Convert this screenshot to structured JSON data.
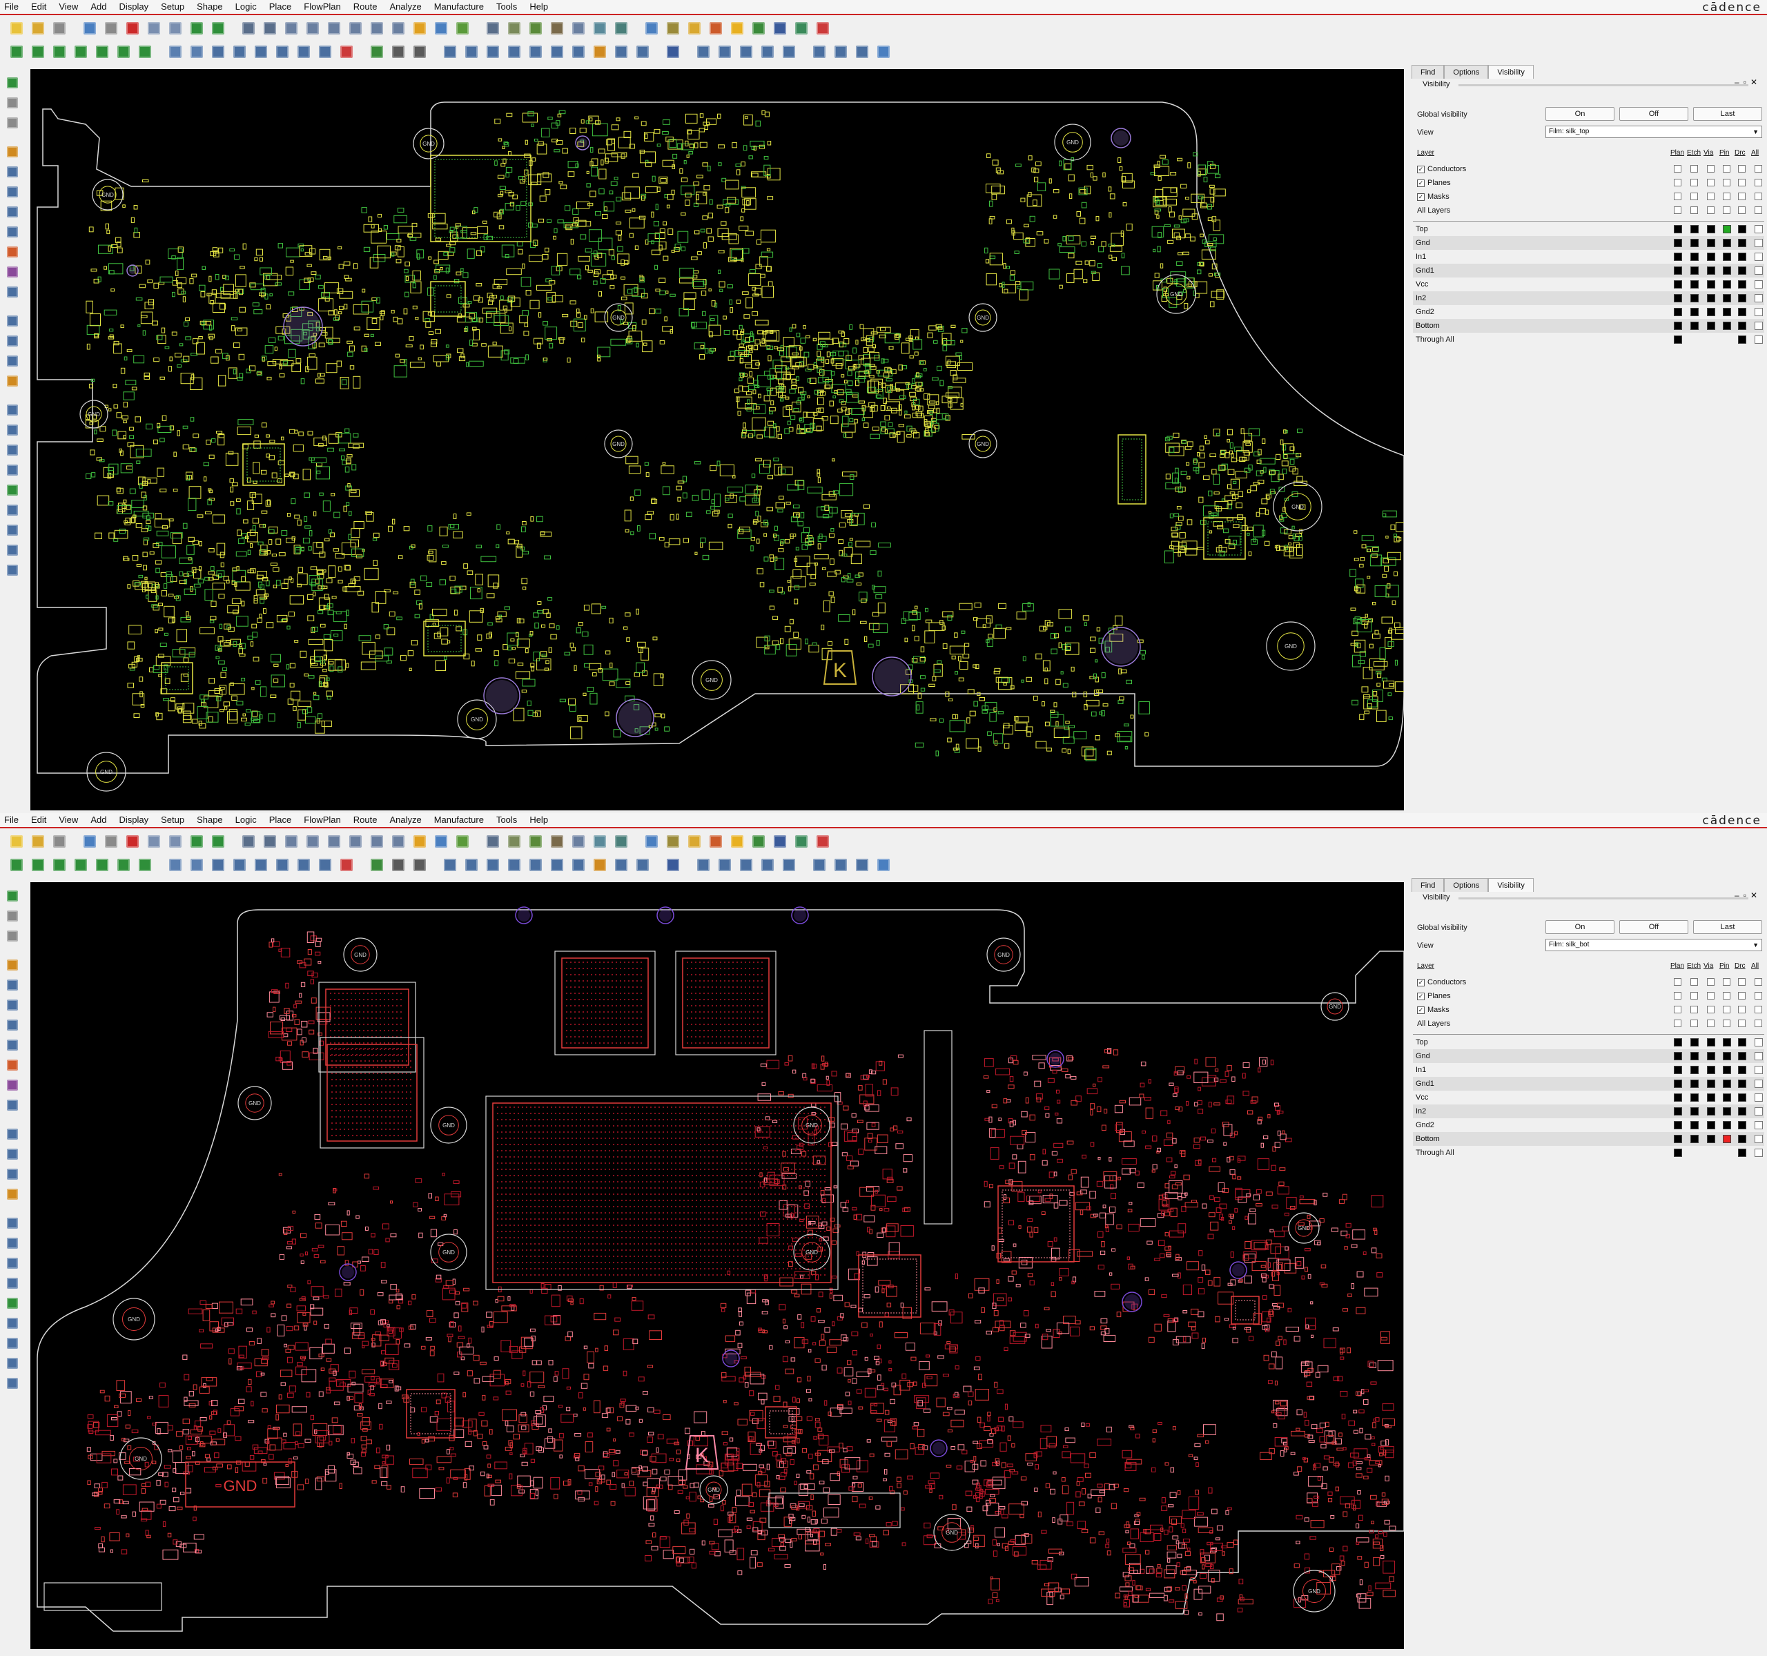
{
  "menu": [
    "File",
    "Edit",
    "View",
    "Add",
    "Display",
    "Setup",
    "Shape",
    "Logic",
    "Place",
    "FlowPlan",
    "Route",
    "Analyze",
    "Manufacture",
    "Tools",
    "Help"
  ],
  "brand": "cādence",
  "toolbar_icons_row1": [
    {
      "name": "new-file-icon",
      "color": "#e8c23a"
    },
    {
      "name": "open-folder-icon",
      "color": "#d9a830"
    },
    {
      "name": "save-icon",
      "color": "#8a8a8a"
    },
    {
      "sep": true
    },
    {
      "name": "move-icon",
      "color": "#4a7fc0"
    },
    {
      "name": "copy-icon",
      "color": "#8a8a8a"
    },
    {
      "name": "delete-icon",
      "color": "#cc2a2a"
    },
    {
      "name": "undo-icon",
      "color": "#7a8fb0"
    },
    {
      "name": "redo-icon",
      "color": "#7a8fb0"
    },
    {
      "name": "ratsnest-icon",
      "color": "#2f8f3a"
    },
    {
      "name": "pin-icon",
      "color": "#2f8f3a"
    },
    {
      "sep": true
    },
    {
      "name": "grid-icon",
      "color": "#5a6e8a"
    },
    {
      "name": "grid-fine-icon",
      "color": "#5a6e8a"
    },
    {
      "name": "zoom-window-icon",
      "color": "#6a7fa0"
    },
    {
      "name": "zoom-in-icon",
      "color": "#6a7fa0"
    },
    {
      "name": "zoom-out-icon",
      "color": "#6a7fa0"
    },
    {
      "name": "zoom-fit-icon",
      "color": "#6a7fa0"
    },
    {
      "name": "zoom-world-icon",
      "color": "#6a7fa0"
    },
    {
      "name": "zoom-previous-icon",
      "color": "#6a7fa0"
    },
    {
      "name": "redraw-icon",
      "color": "#e0a020"
    },
    {
      "name": "3d-view-icon",
      "color": "#4a7fc0"
    },
    {
      "name": "color-dialog-icon",
      "color": "#5a9a3a"
    },
    {
      "sep": true
    },
    {
      "name": "layer-table-icon",
      "color": "#5a6e8a"
    },
    {
      "name": "shape-edit-icon",
      "color": "#7a8a5a"
    },
    {
      "name": "constraint-manager-icon",
      "color": "#5a8a3a"
    },
    {
      "name": "component-icon",
      "color": "#7a6a4a"
    },
    {
      "name": "net-table-icon",
      "color": "#6a7fa0"
    },
    {
      "name": "drc-icon",
      "color": "#5a8a9a"
    },
    {
      "name": "schematic-icon",
      "color": "#4a7f7a"
    },
    {
      "sep": true
    },
    {
      "name": "info-icon",
      "color": "#4a7fc0"
    },
    {
      "name": "properties-icon",
      "color": "#9a8a3a"
    },
    {
      "name": "measure-icon",
      "color": "#d9a830"
    },
    {
      "name": "highlight-icon",
      "color": "#cc5a2a"
    },
    {
      "name": "assign-color-icon",
      "color": "#e8b020"
    },
    {
      "name": "dehighlight-icon",
      "color": "#3a8a3a"
    },
    {
      "name": "report-icon",
      "color": "#3a5a9a"
    },
    {
      "name": "hourglass-icon",
      "color": "#3a8a5a"
    },
    {
      "name": "visibility-icon",
      "color": "#cc3a3a"
    }
  ],
  "toolbar_icons_row2": [
    {
      "name": "layer-top-icon",
      "color": "#2f8f3a"
    },
    {
      "name": "layer-gnd-icon",
      "color": "#2f8f3a"
    },
    {
      "name": "layer-in1-icon",
      "color": "#2f8f3a"
    },
    {
      "name": "layer-gnd1-icon",
      "color": "#2f8f3a"
    },
    {
      "name": "layer-vcc-icon",
      "color": "#2f8f3a"
    },
    {
      "name": "layer-in2-icon",
      "color": "#2f8f3a"
    },
    {
      "name": "layer-bottom-icon",
      "color": "#2f8f3a"
    },
    {
      "sep": true
    },
    {
      "name": "add-connect-icon",
      "color": "#5a7fb0"
    },
    {
      "name": "slide-icon",
      "color": "#5a7fb0"
    },
    {
      "name": "via-icon",
      "color": "#4a6fa0"
    },
    {
      "name": "fanout-icon",
      "color": "#4a6fa0"
    },
    {
      "name": "delay-tune-icon",
      "color": "#4a6fa0"
    },
    {
      "name": "custom-smooth-icon",
      "color": "#4a6fa0"
    },
    {
      "name": "vertex-icon",
      "color": "#4a6fa0"
    },
    {
      "name": "spread-icon",
      "color": "#4a6fa0"
    },
    {
      "name": "connect-line-icon",
      "color": "#cc3a3a"
    },
    {
      "sep": true
    },
    {
      "name": "place-manual-icon",
      "color": "#3a8a3a"
    },
    {
      "name": "dimension-icon",
      "color": "#5a5a5a"
    },
    {
      "name": "measure-line-icon",
      "color": "#5a5a5a"
    },
    {
      "sep": true
    },
    {
      "name": "text-edit-icon",
      "color": "#4a6fa0"
    },
    {
      "name": "silkscreen-icon",
      "color": "#4a6fa0"
    },
    {
      "name": "label-icon",
      "color": "#4a6fa0"
    },
    {
      "name": "nc-drill-icon",
      "color": "#4a6fa0"
    },
    {
      "name": "artwork-icon",
      "color": "#4a6fa0"
    },
    {
      "name": "flag-icon",
      "color": "#4a6fa0"
    },
    {
      "name": "gerber-icon",
      "color": "#4a6fa0"
    },
    {
      "name": "brush-icon",
      "color": "#d08a20"
    },
    {
      "name": "matrix-icon",
      "color": "#4a6fa0"
    },
    {
      "name": "array-icon",
      "color": "#4a6fa0"
    },
    {
      "sep": true
    },
    {
      "name": "signal-integrity-icon",
      "color": "#3a5a9a"
    },
    {
      "sep": true
    },
    {
      "name": "padstack-icon",
      "color": "#4a6fa0"
    },
    {
      "name": "refresh-symbol-icon",
      "color": "#4a6fa0"
    },
    {
      "name": "symbol-icon",
      "color": "#4a6fa0"
    },
    {
      "name": "test-point-icon",
      "color": "#4a6fa0"
    },
    {
      "name": "tool-icon",
      "color": "#4a6fa0"
    },
    {
      "sep": true
    },
    {
      "name": "window-icon",
      "color": "#4a6fa0"
    },
    {
      "name": "image-icon",
      "color": "#4a6fa0"
    },
    {
      "name": "camera-icon",
      "color": "#4a6fa0"
    },
    {
      "name": "help-icon",
      "color": "#4a7fc0"
    }
  ],
  "left_tools": [
    {
      "name": "select-icon",
      "color": "#2f8f3a"
    },
    {
      "name": "general-edit-icon",
      "color": "#8a8a8a"
    },
    {
      "name": "etch-edit-icon",
      "color": "#8a8a8a"
    },
    {
      "sep": true
    },
    {
      "name": "add-line-icon",
      "color": "#d08a20"
    },
    {
      "name": "add-rect-icon",
      "color": "#4a6fa0"
    },
    {
      "name": "add-arc-icon",
      "color": "#4a6fa0"
    },
    {
      "name": "add-pin-icon",
      "color": "#4a6fa0"
    },
    {
      "name": "shape-add-icon",
      "color": "#4a6fa0"
    },
    {
      "name": "shape-edit-boundary-icon",
      "color": "#d05a2a"
    },
    {
      "name": "shape-select-icon",
      "color": "#8a4a9a"
    },
    {
      "name": "shape-merge-icon",
      "color": "#4a6fa0"
    },
    {
      "sep": true
    },
    {
      "name": "line-icon",
      "color": "#4a6fa0"
    },
    {
      "name": "rect-icon",
      "color": "#4a6fa0"
    },
    {
      "name": "circle-icon",
      "color": "#4a6fa0"
    },
    {
      "name": "text-icon",
      "color": "#d08a20"
    },
    {
      "sep": true
    },
    {
      "name": "route-icon",
      "color": "#4a6fa0"
    },
    {
      "name": "route-multi-icon",
      "color": "#4a6fa0"
    },
    {
      "name": "route-diff-icon",
      "color": "#4a6fa0"
    },
    {
      "name": "route-bus-icon",
      "color": "#4a6fa0"
    },
    {
      "name": "route-auto-icon",
      "color": "#2f8f3a"
    },
    {
      "name": "route-push-icon",
      "color": "#4a6fa0"
    },
    {
      "name": "route-glossing-icon",
      "color": "#4a6fa0"
    },
    {
      "name": "route-timing-icon",
      "color": "#4a6fa0"
    },
    {
      "name": "route-check-icon",
      "color": "#4a6fa0"
    }
  ],
  "panel_top": {
    "tabs": [
      "Find",
      "Options",
      "Visibility"
    ],
    "section_title": "Visibility",
    "global_visibility_label": "Global visibility",
    "on": "On",
    "off": "Off",
    "last": "Last",
    "view_label": "View",
    "view_value": "Film: silk_top",
    "layer_label": "Layer",
    "columns": [
      "Plan",
      "Etch",
      "Via",
      "Pin",
      "Drc",
      "All"
    ],
    "categories": [
      {
        "label": "Conductors",
        "checked": true
      },
      {
        "label": "Planes",
        "checked": true
      },
      {
        "label": "Masks",
        "checked": true
      },
      {
        "label": "All Layers",
        "checked": false
      }
    ],
    "layers": [
      {
        "name": "Top",
        "cells": [
          "#000000",
          "#000000",
          "#000000",
          "#22aa22",
          "#000000",
          "empty"
        ]
      },
      {
        "name": "Gnd",
        "cells": [
          "#000000",
          "#000000",
          "#000000",
          "#000000",
          "#000000",
          "empty"
        ]
      },
      {
        "name": "In1",
        "cells": [
          "#000000",
          "#000000",
          "#000000",
          "#000000",
          "#000000",
          "empty"
        ]
      },
      {
        "name": "Gnd1",
        "cells": [
          "#000000",
          "#000000",
          "#000000",
          "#000000",
          "#000000",
          "empty"
        ]
      },
      {
        "name": "Vcc",
        "cells": [
          "#000000",
          "#000000",
          "#000000",
          "#000000",
          "#000000",
          "empty"
        ]
      },
      {
        "name": "In2",
        "cells": [
          "#000000",
          "#000000",
          "#000000",
          "#000000",
          "#000000",
          "empty"
        ]
      },
      {
        "name": "Gnd2",
        "cells": [
          "#000000",
          "#000000",
          "#000000",
          "#000000",
          "#000000",
          "empty"
        ]
      },
      {
        "name": "Bottom",
        "cells": [
          "#000000",
          "#000000",
          "#000000",
          "#000000",
          "#000000",
          "empty"
        ]
      },
      {
        "name": "Through All",
        "cells": [
          "#000000",
          null,
          null,
          null,
          "#000000",
          "empty"
        ]
      }
    ]
  },
  "panel_bot": {
    "tabs": [
      "Find",
      "Options",
      "Visibility"
    ],
    "section_title": "Visibility",
    "global_visibility_label": "Global visibility",
    "on": "On",
    "off": "Off",
    "last": "Last",
    "view_label": "View",
    "view_value": "Film: silk_bot",
    "layer_label": "Layer",
    "columns": [
      "Plan",
      "Etch",
      "Via",
      "Pin",
      "Drc",
      "All"
    ],
    "categories": [
      {
        "label": "Conductors",
        "checked": true
      },
      {
        "label": "Planes",
        "checked": true
      },
      {
        "label": "Masks",
        "checked": true
      },
      {
        "label": "All Layers",
        "checked": false
      }
    ],
    "layers": [
      {
        "name": "Top",
        "cells": [
          "#000000",
          "#000000",
          "#000000",
          "#000000",
          "#000000",
          "empty"
        ]
      },
      {
        "name": "Gnd",
        "cells": [
          "#000000",
          "#000000",
          "#000000",
          "#000000",
          "#000000",
          "empty"
        ]
      },
      {
        "name": "In1",
        "cells": [
          "#000000",
          "#000000",
          "#000000",
          "#000000",
          "#000000",
          "empty"
        ]
      },
      {
        "name": "Gnd1",
        "cells": [
          "#000000",
          "#000000",
          "#000000",
          "#000000",
          "#000000",
          "empty"
        ]
      },
      {
        "name": "Vcc",
        "cells": [
          "#000000",
          "#000000",
          "#000000",
          "#000000",
          "#000000",
          "empty"
        ]
      },
      {
        "name": "In2",
        "cells": [
          "#000000",
          "#000000",
          "#000000",
          "#000000",
          "#000000",
          "empty"
        ]
      },
      {
        "name": "Gnd2",
        "cells": [
          "#000000",
          "#000000",
          "#000000",
          "#000000",
          "#000000",
          "empty"
        ]
      },
      {
        "name": "Bottom",
        "cells": [
          "#000000",
          "#000000",
          "#000000",
          "#ee2222",
          "#000000",
          "empty"
        ]
      },
      {
        "name": "Through All",
        "cells": [
          "#000000",
          null,
          null,
          null,
          "#000000",
          "empty"
        ]
      }
    ]
  },
  "board_top": {
    "outline_color": "#d8d8d8",
    "silk_colors": [
      "#e6e645",
      "#3fbf3f",
      "#e6e645"
    ],
    "mark_color": "#c9b23a",
    "hole_color": "#9a7ad8",
    "board_letter": "K",
    "hole_label": "GND"
  },
  "board_bot": {
    "outline_color": "#d8d8d8",
    "silk_colors": [
      "#e23a3a",
      "#ff8a9a",
      "#c0182a"
    ],
    "mark_color": "#ff8aa8",
    "hole_color": "#7a4ad8",
    "board_letter": "K",
    "gnd_text": "GND",
    "hole_label": "GND"
  }
}
